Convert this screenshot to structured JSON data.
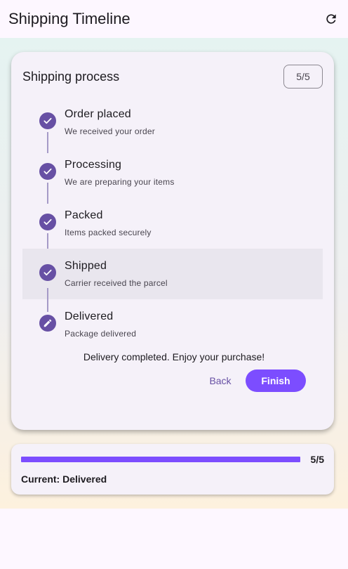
{
  "appbar": {
    "title": "Shipping Timeline",
    "refresh_icon": "refresh-icon"
  },
  "card": {
    "title": "Shipping process",
    "counter": "5/5"
  },
  "steps": [
    {
      "title": "Order placed",
      "subtitle": "We received your order",
      "state": "done",
      "icon": "check-icon"
    },
    {
      "title": "Processing",
      "subtitle": "We are preparing your items",
      "state": "done",
      "icon": "check-icon"
    },
    {
      "title": "Packed",
      "subtitle": "Items packed securely",
      "state": "done",
      "icon": "check-icon"
    },
    {
      "title": "Shipped",
      "subtitle": "Carrier received the parcel",
      "state": "done",
      "icon": "check-icon",
      "highlighted": true
    },
    {
      "title": "Delivered",
      "subtitle": "Package delivered",
      "state": "editing",
      "icon": "pencil-icon"
    }
  ],
  "completed_message": "Delivery completed. Enjoy your purchase!",
  "actions": {
    "back_label": "Back",
    "finish_label": "Finish"
  },
  "status": {
    "progress_fraction": 1.0,
    "progress_label": "5/5",
    "current_prefix": "Current: ",
    "current_value": "Delivered"
  },
  "colors": {
    "primary": "#6750a4",
    "accent": "#7c4dff",
    "connector": "#a59ac7"
  }
}
